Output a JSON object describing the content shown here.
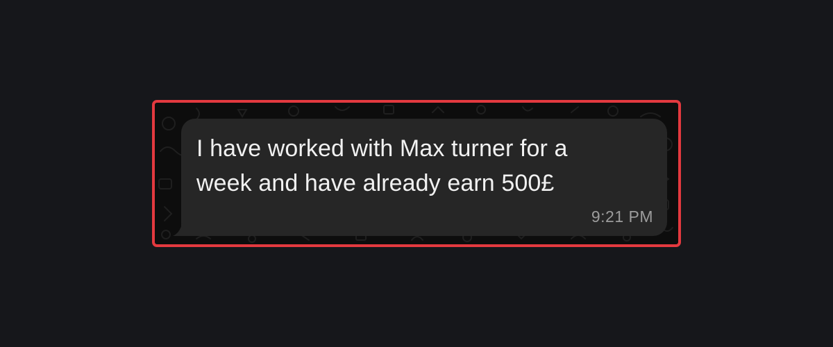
{
  "message": {
    "text": "I have worked with Max turner for a\nweek and have already earn 500£",
    "time": "9:21 PM"
  },
  "colors": {
    "page_background": "#16171b",
    "highlight_border": "#e3393f",
    "bubble_background": "#262626",
    "message_text": "#f1f1f1",
    "timestamp_text": "#9c9c9c"
  },
  "icons": [
    "chat-wallpaper-doodles"
  ]
}
